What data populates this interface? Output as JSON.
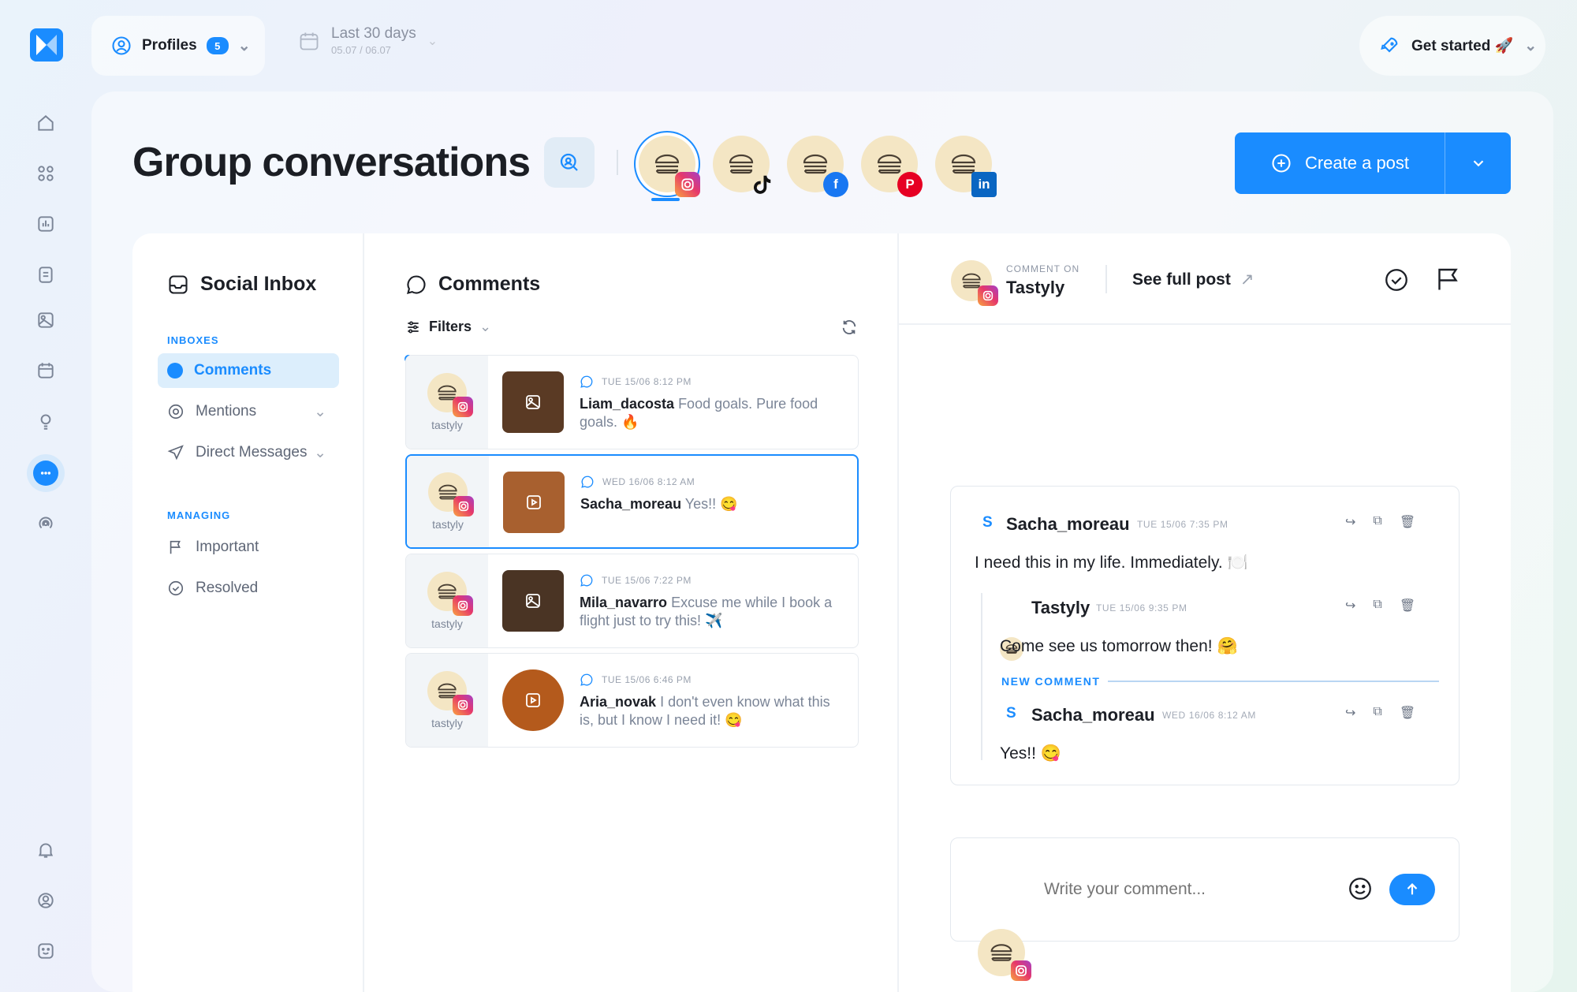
{
  "topbar": {
    "profiles_label": "Profiles",
    "profiles_count": "5",
    "date_label": "Last 30 days",
    "date_range": "05.07 / 06.07",
    "get_started": "Get started 🚀"
  },
  "page": {
    "title": "Group conversations",
    "create_post": "Create a post"
  },
  "networks": [
    "instagram",
    "tiktok",
    "facebook",
    "pinterest",
    "linkedin"
  ],
  "inbox": {
    "title": "Social Inbox",
    "inboxes_heading": "INBOXES",
    "items": [
      "Comments",
      "Mentions",
      "Direct Messages"
    ],
    "managing_heading": "MANAGING",
    "managing": [
      "Important",
      "Resolved"
    ]
  },
  "comments": {
    "title": "Comments",
    "filters": "Filters",
    "list": [
      {
        "account": "tastyly",
        "time": "TUE 15/06 8:12 PM",
        "user": "Liam_dacosta",
        "text": " Food goals. Pure food goals. 🔥",
        "thumb": "#5a3a24"
      },
      {
        "account": "tastyly",
        "time": "WED 16/06 8:12 AM",
        "user": "Sacha_moreau",
        "text": " Yes!! 😋",
        "thumb": "#a8602f"
      },
      {
        "account": "tastyly",
        "time": "TUE 15/06 7:22 PM",
        "user": "Mila_navarro",
        "text": " Excuse me while I book a flight just to try this! ✈️",
        "thumb": "#4a3424"
      },
      {
        "account": "tastyly",
        "time": "TUE 15/06 6:46 PM",
        "user": "Aria_novak",
        "text": " I don't even know what this is, but I know I need it! 😋",
        "thumb": "#b45a1c"
      }
    ]
  },
  "detail": {
    "comment_on_label": "COMMENT ON",
    "comment_on_name": "Tastyly",
    "see_full_post": "See full post",
    "thread": {
      "main_initial": "S",
      "main_user": "Sacha_moreau",
      "main_time": "TUE 15/06 7:35 PM",
      "main_text": "I need this in my life. Immediately. 🍽️",
      "reply_user": "Tastyly",
      "reply_time": "TUE 15/06 9:35 PM",
      "reply_text": "Come see us tomorrow then! 🤗",
      "new_comment_label": "NEW COMMENT",
      "new_initial": "S",
      "new_user": "Sacha_moreau",
      "new_time": "WED 16/06 8:12 AM",
      "new_text": "Yes!! 😋"
    },
    "composer_placeholder": "Write your comment..."
  },
  "colors": {
    "accent": "#1a8cff",
    "avatar_bg": "#f4e6c4"
  }
}
